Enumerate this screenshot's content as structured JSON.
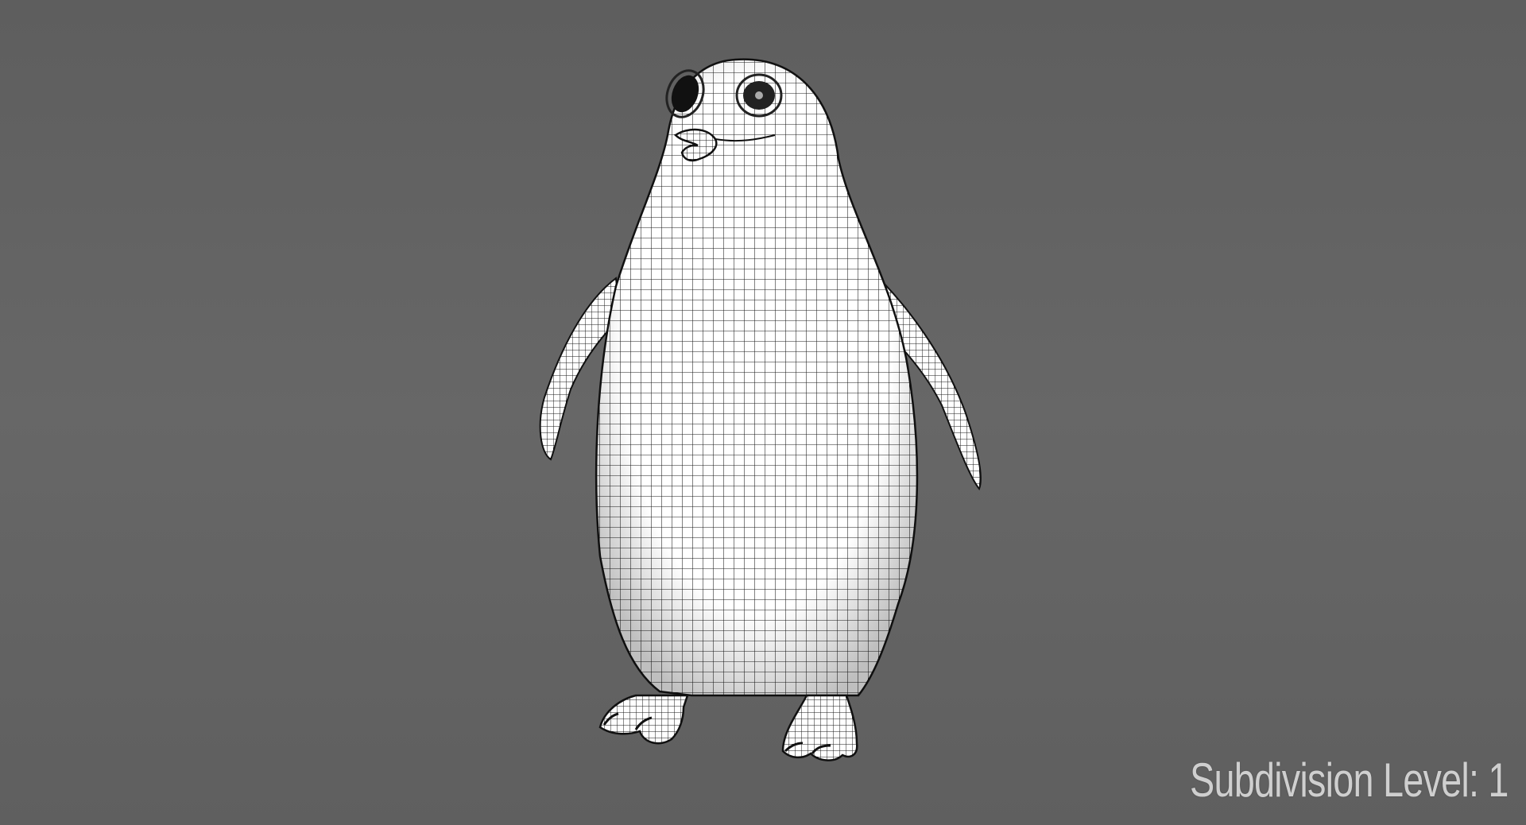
{
  "viewport": {
    "background_color": "#636363",
    "overlay_label": "Subdivision Level: 1"
  },
  "model": {
    "subject": "penguin-icon",
    "display_mode": "wireframe",
    "surface_color": "#ffffff",
    "wire_color": "#1a1a1a"
  }
}
